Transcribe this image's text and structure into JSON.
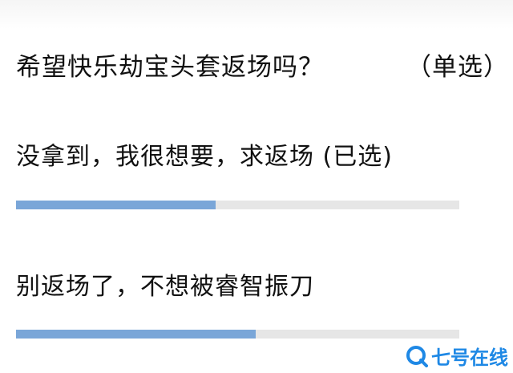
{
  "poll": {
    "question": "希望快乐劫宝头套返场吗？",
    "mode": "（单选）",
    "options": [
      {
        "label": "没拿到，我很想要，求返场 (已选)",
        "fraction": 0.45
      },
      {
        "label": "别返场了，不想被睿智振刀",
        "fraction": 0.54
      }
    ]
  },
  "watermark": {
    "text": "七号在线",
    "icon": "search-q-icon"
  },
  "colors": {
    "bar_fill": "#7aa6d8",
    "bar_track": "#e6e6e6",
    "watermark": "#1e88e5"
  }
}
